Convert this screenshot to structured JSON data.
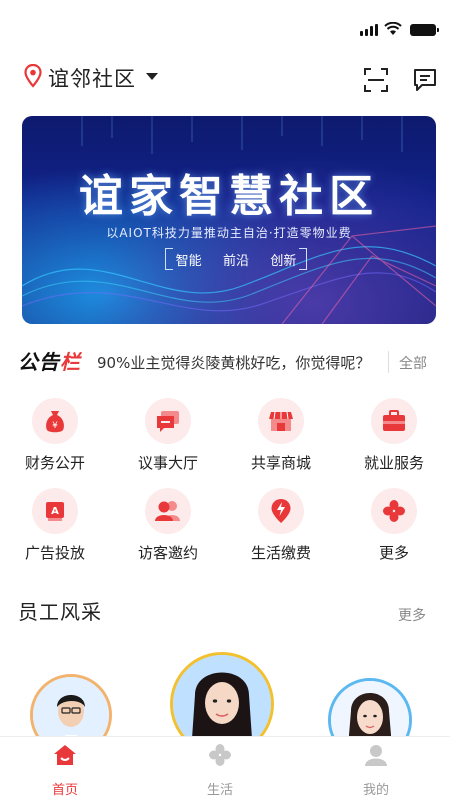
{
  "header": {
    "location": "谊邻社区"
  },
  "banner": {
    "title": "谊家智慧社区",
    "subtitle": "以AIOT科技力量推动主自治·打造零物业费",
    "tags": [
      "智能",
      "前沿",
      "创新"
    ]
  },
  "notice": {
    "logo_black": "公告",
    "logo_red": "栏",
    "text": "90%业主觉得炎陵黄桃好吃，你觉得呢？",
    "all_label": "全部"
  },
  "services": [
    {
      "label": "财务公开",
      "icon": "money-bag-icon"
    },
    {
      "label": "议事大厅",
      "icon": "chat-icon"
    },
    {
      "label": "共享商城",
      "icon": "store-icon"
    },
    {
      "label": "就业服务",
      "icon": "briefcase-icon"
    },
    {
      "label": "广告投放",
      "icon": "ad-icon"
    },
    {
      "label": "访客邀约",
      "icon": "visitors-icon"
    },
    {
      "label": "生活缴费",
      "icon": "payment-icon"
    },
    {
      "label": "更多",
      "icon": "more-icon"
    }
  ],
  "staff": {
    "title": "员工风采",
    "more_label": "更多"
  },
  "tabbar": {
    "tabs": [
      {
        "label": "首页",
        "icon": "home-icon",
        "active": true
      },
      {
        "label": "生活",
        "icon": "life-icon",
        "active": false
      },
      {
        "label": "我的",
        "icon": "profile-icon",
        "active": false
      }
    ]
  },
  "colors": {
    "accent": "#e8383a",
    "icon_bg": "#fdeaea",
    "inactive": "#999999"
  }
}
